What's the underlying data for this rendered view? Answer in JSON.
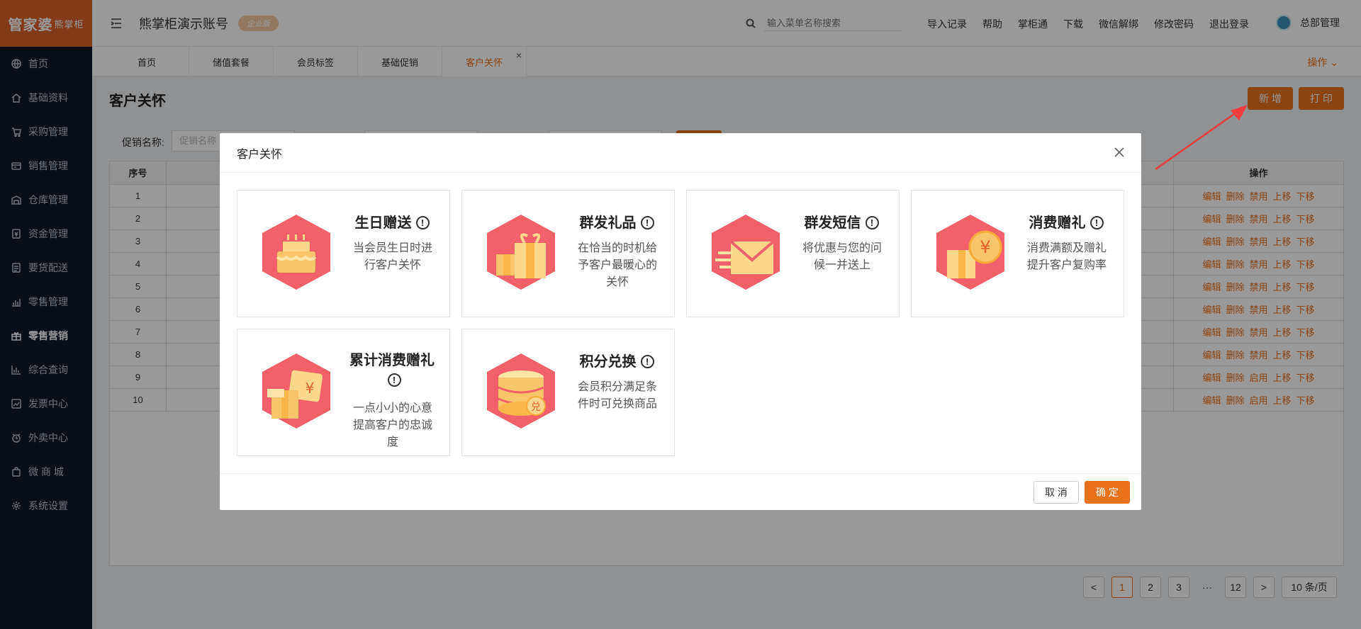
{
  "logo": {
    "text": "管家婆",
    "sub": "熊掌柜"
  },
  "sidebar": {
    "items": [
      {
        "label": "首页",
        "icon": "globe-icon"
      },
      {
        "label": "基础资料",
        "icon": "home-icon"
      },
      {
        "label": "采购管理",
        "icon": "cart-icon"
      },
      {
        "label": "销售管理",
        "icon": "card-icon"
      },
      {
        "label": "仓库管理",
        "icon": "warehouse-icon"
      },
      {
        "label": "资金管理",
        "icon": "money-icon"
      },
      {
        "label": "要货配送",
        "icon": "document-icon"
      },
      {
        "label": "零售管理",
        "icon": "chart-icon"
      },
      {
        "label": "零售营销",
        "icon": "gift-icon"
      },
      {
        "label": "综合查询",
        "icon": "bar-chart-icon"
      },
      {
        "label": "发票中心",
        "icon": "trend-icon"
      },
      {
        "label": "外卖中心",
        "icon": "alarm-icon"
      },
      {
        "label": "微 商 城",
        "icon": "bag-icon"
      },
      {
        "label": "系统设置",
        "icon": "gear-icon"
      }
    ]
  },
  "header": {
    "account": "熊掌柜演示账号",
    "badge": "企业版",
    "search_placeholder": "输入菜单名称搜索",
    "links": [
      "导入记录",
      "帮助",
      "掌柜通",
      "下载",
      "微信解绑",
      "修改密码",
      "退出登录"
    ],
    "user": "总部管理"
  },
  "tabs": [
    "首页",
    "储值套餐",
    "会员标签",
    "基础促销",
    "客户关怀"
  ],
  "ops_label": "操作",
  "page": {
    "title": "客户关怀",
    "add_label": "新 增",
    "print_label": "打 印",
    "filter_label": "促销名称:",
    "filter_placeholder": "促销名称"
  },
  "table": {
    "col_seq": "序号",
    "col_op": "操作",
    "rows": [
      {
        "seq": "1",
        "toggle": "禁用"
      },
      {
        "seq": "2",
        "toggle": "禁用"
      },
      {
        "seq": "3",
        "toggle": "禁用"
      },
      {
        "seq": "4",
        "toggle": "禁用"
      },
      {
        "seq": "5",
        "toggle": "禁用"
      },
      {
        "seq": "6",
        "toggle": "禁用"
      },
      {
        "seq": "7",
        "toggle": "禁用"
      },
      {
        "seq": "8",
        "toggle": "禁用"
      },
      {
        "seq": "9",
        "toggle": "启用"
      },
      {
        "seq": "10",
        "toggle": "启用"
      }
    ],
    "actions": {
      "edit": "编辑",
      "delete": "删除",
      "up": "上移",
      "down": "下移"
    }
  },
  "pager": {
    "pages": [
      "1",
      "2",
      "3",
      "···",
      "12"
    ],
    "prev": "<",
    "next": ">",
    "size": "10 条/页"
  },
  "modal": {
    "title": "客户关怀",
    "cards": [
      {
        "title": "生日赠送",
        "desc": "当会员生日时进行客户关怀",
        "icon": "birthday-cake-icon"
      },
      {
        "title": "群发礼品",
        "desc": "在恰当的时机给予客户最暖心的关怀",
        "icon": "gift-box-icon"
      },
      {
        "title": "群发短信",
        "desc": "将优惠与您的问候一并送上",
        "icon": "envelope-icon"
      },
      {
        "title": "消费赠礼",
        "desc": "消费满额及赠礼提升客户复购率",
        "icon": "yuan-gift-icon"
      },
      {
        "title": "累计消费赠礼",
        "desc": "一点小小的心意提高客户的忠诚度",
        "icon": "coupon-gift-icon"
      },
      {
        "title": "积分兑换",
        "desc": "会员积分满足条件时可兑换商品",
        "icon": "coin-stack-icon"
      }
    ],
    "info_symbol": "!",
    "cancel_label": "取 消",
    "ok_label": "确 定"
  },
  "colors": {
    "accent": "#e8711c",
    "sidebar": "#0f1a2b",
    "icon_bg": "#f2606a",
    "icon_fg": "#f9c56b"
  }
}
